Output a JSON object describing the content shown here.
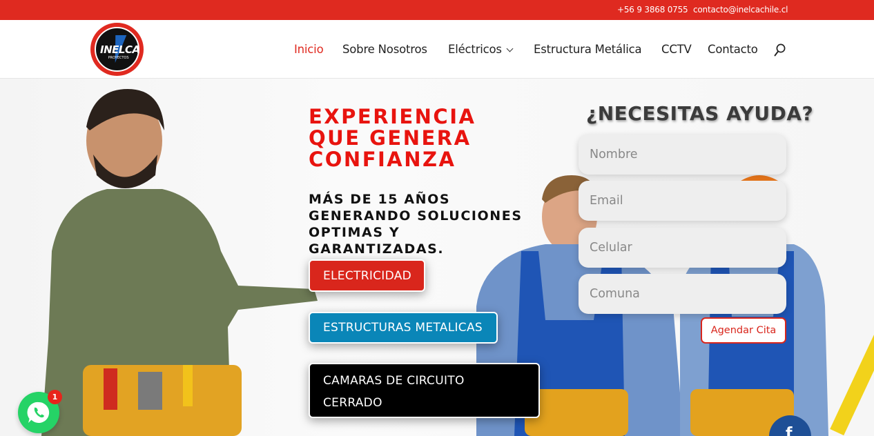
{
  "topbar": {
    "phone": "+56 9 3868 0755",
    "email": "contacto@inelcachile.cl"
  },
  "brand": {
    "logo_text": "INELCA",
    "logo_sub": "PROYECTOS",
    "logo_red": "#e02a20"
  },
  "nav": {
    "items": [
      {
        "label": "Inicio",
        "active": true
      },
      {
        "label": "Sobre Nosotros"
      },
      {
        "label": "Eléctricos",
        "has_dropdown": true
      },
      {
        "label": "Estructura Metálica"
      },
      {
        "label": "CCTV"
      },
      {
        "label": "Contacto"
      }
    ],
    "search_icon": "search-icon"
  },
  "hero": {
    "headline": "EXPERIENCIA QUE GENERA CONFIANZA",
    "subline": "MÁS DE 15 AÑOS GENERANDO SOLUCIONES OPTIMAS Y GARANTIZADAS.",
    "buttons": [
      {
        "label": "ELECTRICIDAD",
        "color": "#d9261c"
      },
      {
        "label": "ESTRUCTURAS METALICAS",
        "color": "#0a86b8"
      },
      {
        "label": "CAMARAS DE CIRCUITO\nCERRADO",
        "color": "#000000"
      }
    ]
  },
  "form": {
    "title": "¿NECESITAS AYUDA?",
    "fields": [
      {
        "placeholder": "Nombre"
      },
      {
        "placeholder": "Email"
      },
      {
        "placeholder": "Celular"
      },
      {
        "placeholder": "Comuna"
      }
    ],
    "submit": "Agendar Cita"
  },
  "floating": {
    "whatsapp_icon": "whatsapp-icon",
    "whatsapp_badge": "1",
    "facebook_icon": "facebook-icon",
    "facebook_glyph": "f"
  }
}
